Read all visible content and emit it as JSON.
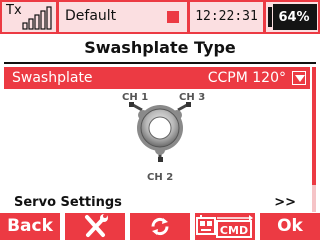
{
  "status_bar": {
    "tx_label": "Tx",
    "signal_bars": 5,
    "model_name": "Default",
    "time": "12:22:31",
    "battery": "64%"
  },
  "page": {
    "title": "Swashplate Type"
  },
  "swashplate": {
    "label": "Swashplate",
    "value": "CCPM 120°",
    "selected": true
  },
  "diagram": {
    "ch1": "CH 1",
    "ch2": "CH 2",
    "ch3": "CH 3"
  },
  "servo_settings": {
    "label": "Servo Settings",
    "arrow": ">>"
  },
  "bottom_bar": {
    "back": "Back",
    "tools_icon": "wrench-screwdriver-icon",
    "refresh_icon": "refresh-icon",
    "cmd_icon": "cmd-icon",
    "cmd_label": "CMD",
    "ok": "Ok"
  },
  "colors": {
    "accent": "#ec3a43",
    "accent_light": "#fbdfe1",
    "battery_bg": "#141414"
  }
}
